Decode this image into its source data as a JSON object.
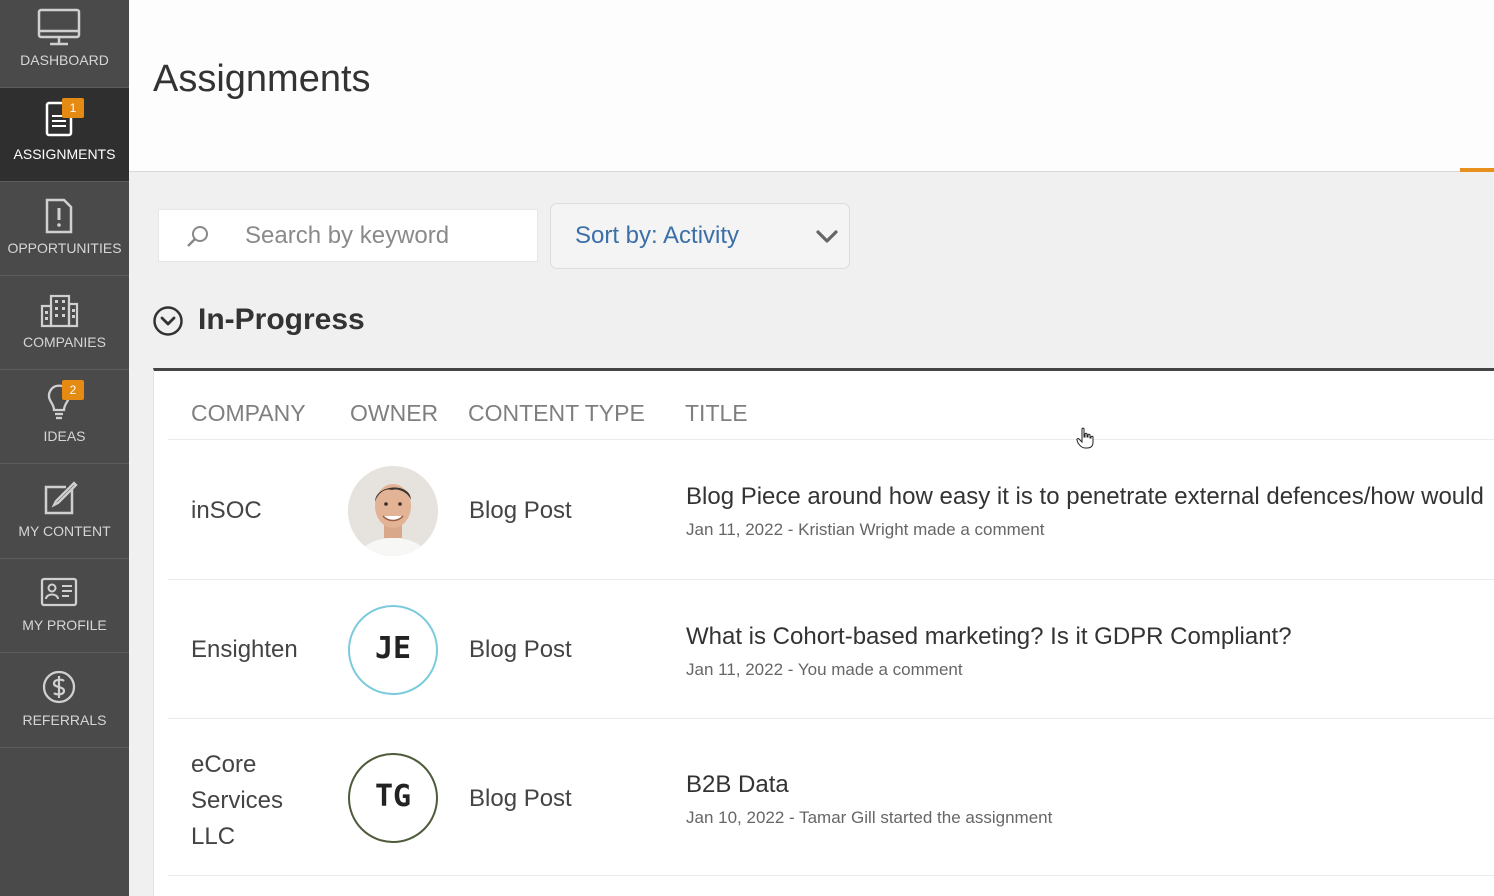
{
  "sidebar": {
    "items": [
      {
        "label": "DASHBOARD",
        "icon": "monitor-icon"
      },
      {
        "label": "ASSIGNMENTS",
        "icon": "document-icon",
        "badge": "1",
        "active": true
      },
      {
        "label": "OPPORTUNITIES",
        "icon": "alert-document-icon"
      },
      {
        "label": "COMPANIES",
        "icon": "building-icon"
      },
      {
        "label": "IDEAS",
        "icon": "lightbulb-icon",
        "badge": "2"
      },
      {
        "label": "MY CONTENT",
        "icon": "edit-icon"
      },
      {
        "label": "MY PROFILE",
        "icon": "id-card-icon"
      },
      {
        "label": "REFERRALS",
        "icon": "dollar-icon"
      }
    ]
  },
  "header": {
    "title": "Assignments"
  },
  "search": {
    "placeholder": "Search by keyword"
  },
  "sort": {
    "label": "Sort by: Activity"
  },
  "section": {
    "title": "In-Progress"
  },
  "table": {
    "columns": [
      "COMPANY",
      "OWNER",
      "CONTENT TYPE",
      "TITLE"
    ],
    "rows": [
      {
        "company": "inSOC",
        "owner_initials": "",
        "content_type": "Blog Post",
        "title": "Blog Piece around how easy it is to penetrate external defences/how would",
        "meta": "Jan 11, 2022 - Kristian Wright made a comment"
      },
      {
        "company": "Ensighten",
        "owner_initials": "JE",
        "content_type": "Blog Post",
        "title": "What is Cohort-based marketing? Is it GDPR Compliant?",
        "meta": "Jan 11, 2022 - You made a comment"
      },
      {
        "company": "eCore Services LLC",
        "company_lines": [
          "eCore",
          "Services",
          "LLC"
        ],
        "owner_initials": "TG",
        "content_type": "Blog Post",
        "title": "B2B Data",
        "meta": "Jan 10, 2022 - Tamar Gill started the assignment"
      }
    ]
  },
  "colors": {
    "accent": "#e58a12",
    "sidebar": "#4a4a4a",
    "sidebar_active": "#2f2f2f",
    "link": "#3b6fa8",
    "avatar_je": "#7ccbdc",
    "avatar_tg": "#4d5b3b"
  }
}
